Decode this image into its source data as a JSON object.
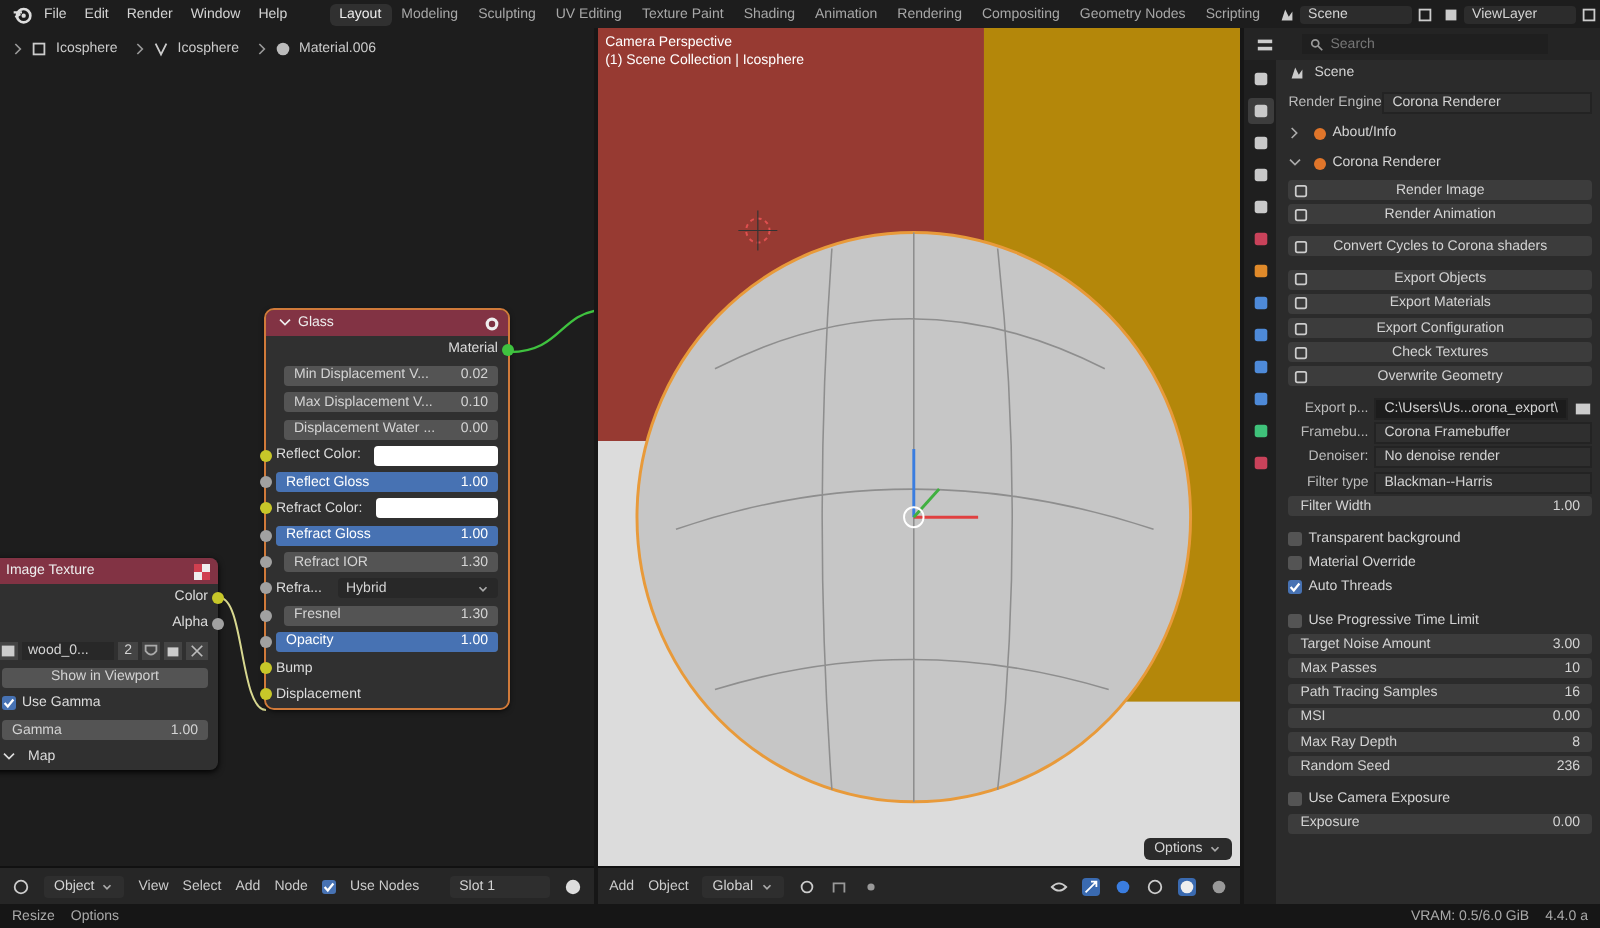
{
  "menu": [
    "File",
    "Edit",
    "Render",
    "Window",
    "Help"
  ],
  "workspaces": [
    {
      "label": "Layout",
      "selected": true
    },
    {
      "label": "Modeling",
      "selected": false
    },
    {
      "label": "Sculpting",
      "selected": false
    },
    {
      "label": "UV Editing",
      "selected": false
    },
    {
      "label": "Texture Paint",
      "selected": false
    },
    {
      "label": "Shading",
      "selected": false
    },
    {
      "label": "Animation",
      "selected": false
    },
    {
      "label": "Rendering",
      "selected": false
    },
    {
      "label": "Compositing",
      "selected": false
    },
    {
      "label": "Geometry Nodes",
      "selected": false
    },
    {
      "label": "Scripting",
      "selected": false
    }
  ],
  "scene": "Scene",
  "view_layer": "ViewLayer",
  "node_editor": {
    "breadcrumbs": [
      "Icosphere",
      "Icosphere",
      "Material.006"
    ],
    "nodes": [
      {
        "title": "Glass",
        "rows": [
          {
            "kind": "output",
            "label": "Material",
            "color": "#3fc23f"
          },
          {
            "kind": "field",
            "label": "Min Displacement V...",
            "value": "0.02"
          },
          {
            "kind": "field",
            "label": "Max Displacement V...",
            "value": "0.10"
          },
          {
            "kind": "field",
            "label": "Displacement Water ...",
            "value": "0.00"
          },
          {
            "kind": "color",
            "label": "Reflect Color:",
            "color": "#c7c729"
          },
          {
            "kind": "slider",
            "label": "Reflect Gloss",
            "value": "1.00",
            "level": 1,
            "color": "#a1a1a1"
          },
          {
            "kind": "color",
            "label": "Refract Color:",
            "color": "#c7c729"
          },
          {
            "kind": "slider",
            "label": "Refract Gloss",
            "value": "1.00",
            "level": 1,
            "color": "#a1a1a1"
          },
          {
            "kind": "field",
            "label": "Refract IOR",
            "value": "1.30",
            "color": "#a1a1a1"
          },
          {
            "kind": "dropdown",
            "label": "Refra...",
            "value": "Hybrid",
            "color": "#a1a1a1"
          },
          {
            "kind": "field",
            "label": "Fresnel",
            "value": "1.30",
            "color": "#a1a1a1"
          },
          {
            "kind": "slider",
            "label": "Opacity",
            "value": "1.00",
            "level": 1,
            "color": "#a1a1a1"
          },
          {
            "kind": "input",
            "label": "Bump",
            "color": "#c7c729"
          },
          {
            "kind": "input",
            "label": "Displacement",
            "color": "#c7c729"
          }
        ]
      },
      {
        "title": "Image Texture",
        "rows": [
          {
            "kind": "output",
            "label": "Color",
            "color": "#c7c729"
          },
          {
            "kind": "output",
            "label": "Alpha",
            "color": "#a1a1a1"
          },
          {
            "kind": "image",
            "value": "wood_0...",
            "users": "2"
          },
          {
            "kind": "button",
            "label": "Show in Viewport"
          },
          {
            "kind": "checkbox",
            "label": "Use Gamma",
            "checked": true
          },
          {
            "kind": "field",
            "label": "Gamma",
            "value": "1.00"
          },
          {
            "kind": "panel",
            "label": "Map",
            "expanded": true
          }
        ]
      }
    ],
    "mode": "Object",
    "menus": [
      "View",
      "Select",
      "Add",
      "Node"
    ],
    "use_nodes": {
      "label": "Use Nodes",
      "checked": true
    },
    "slot": "Slot 1"
  },
  "viewport": {
    "overlay": [
      "Camera Perspective",
      "(1) Scene Collection | Icosphere"
    ],
    "menus": [
      "Add",
      "Object"
    ],
    "orientation": "Global",
    "options": "Options"
  },
  "properties": {
    "search": {
      "placeholder": "Search"
    },
    "context": "Scene",
    "engine_label": "Render Engine",
    "engine": "Corona Renderer",
    "tabs": [
      {
        "selected": false,
        "color": "#c9c9c9"
      },
      {
        "selected": true,
        "color": "#c9c9c9"
      },
      {
        "selected": false,
        "color": "#c9c9c9"
      },
      {
        "selected": false,
        "color": "#c9c9c9"
      },
      {
        "selected": false,
        "color": "#c9c9c9"
      },
      {
        "selected": false,
        "color": "#c9425a"
      },
      {
        "selected": false,
        "color": "#e08a2a"
      },
      {
        "selected": false,
        "color": "#4e8ad8"
      },
      {
        "selected": false,
        "color": "#4e8ad8"
      },
      {
        "selected": false,
        "color": "#4e8ad8"
      },
      {
        "selected": false,
        "color": "#4e8ad8"
      },
      {
        "selected": false,
        "color": "#3fc27a"
      },
      {
        "selected": false,
        "color": "#c9425a"
      }
    ],
    "rows": [
      {
        "kind": "panel",
        "label": "About/Info",
        "expanded": false
      },
      {
        "kind": "panel",
        "label": "Corona Renderer",
        "expanded": true
      },
      {
        "kind": "button",
        "label": "Render Image"
      },
      {
        "kind": "button",
        "label": "Render Animation"
      },
      {
        "kind": "button",
        "label": "Convert Cycles to Corona shaders"
      },
      {
        "kind": "button",
        "label": "Export Objects"
      },
      {
        "kind": "button",
        "label": "Export Materials"
      },
      {
        "kind": "button",
        "label": "Export Configuration"
      },
      {
        "kind": "button",
        "label": "Check Textures"
      },
      {
        "kind": "button",
        "label": "Overwrite Geometry"
      },
      {
        "kind": "path",
        "label": "Export p...",
        "value": "C:\\Users\\Us...orona_export\\"
      },
      {
        "kind": "dropdown",
        "label": "Framebu...",
        "value": "Corona Framebuffer"
      },
      {
        "kind": "dropdown",
        "label": "Denoiser:",
        "value": "No denoise render"
      },
      {
        "kind": "dropdown",
        "label": "Filter type",
        "value": "Blackman--Harris"
      },
      {
        "kind": "number",
        "label": "Filter Width",
        "value": "1.00"
      },
      {
        "kind": "checkbox",
        "label": "Transparent background",
        "checked": false
      },
      {
        "kind": "checkbox",
        "label": "Material Override",
        "checked": false
      },
      {
        "kind": "checkbox",
        "label": "Auto Threads",
        "checked": true
      },
      {
        "kind": "checkbox",
        "label": "Use Progressive Time Limit",
        "checked": false
      },
      {
        "kind": "number",
        "label": "Target Noise Amount",
        "value": "3.00"
      },
      {
        "kind": "number",
        "label": "Max Passes",
        "value": "10"
      },
      {
        "kind": "number",
        "label": "Path Tracing Samples",
        "value": "16"
      },
      {
        "kind": "number",
        "label": "MSI",
        "value": "0.00"
      },
      {
        "kind": "number",
        "label": "Max Ray Depth",
        "value": "8"
      },
      {
        "kind": "number",
        "label": "Random Seed",
        "value": "236"
      },
      {
        "kind": "checkbox",
        "label": "Use Camera Exposure",
        "checked": false
      },
      {
        "kind": "number",
        "label": "Exposure",
        "value": "0.00"
      }
    ]
  },
  "status_bar": {
    "hints": [
      "Resize",
      "Options"
    ],
    "vram": "VRAM: 0.5/6.0 GiB",
    "version": "4.4.0 a"
  }
}
